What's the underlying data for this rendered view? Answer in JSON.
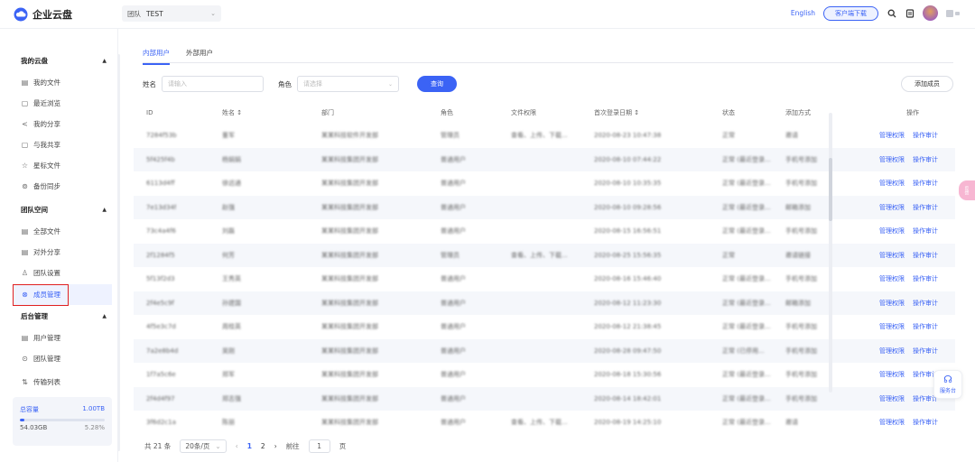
{
  "header": {
    "logo_text": "企业云盘",
    "team_label": "团队",
    "team_value": "TEST",
    "lang": "English",
    "download_label": "客户端下载",
    "brand_color": "#3b63f5"
  },
  "sidebar": {
    "my_group": "我的云盘",
    "my_items": [
      {
        "label": "我的文件",
        "icon": "file-icon"
      },
      {
        "label": "最近浏览",
        "icon": "recent-icon"
      },
      {
        "label": "我的分享",
        "icon": "share-icon"
      },
      {
        "label": "与我共享",
        "icon": "shared-with-me-icon"
      },
      {
        "label": "星标文件",
        "icon": "star-icon"
      },
      {
        "label": "备份同步",
        "icon": "sync-icon"
      }
    ],
    "team_group": "团队空间",
    "team_items": [
      {
        "label": "全部文件",
        "icon": "file-icon"
      },
      {
        "label": "对外分享",
        "icon": "external-share-icon"
      },
      {
        "label": "团队设置",
        "icon": "team-settings-icon"
      },
      {
        "label": "成员管理",
        "icon": "members-icon"
      }
    ],
    "admin_group": "后台管理",
    "admin_items": [
      {
        "label": "用户管理",
        "icon": "user-icon"
      },
      {
        "label": "团队管理",
        "icon": "team-icon"
      }
    ],
    "transfer_label": "传输列表",
    "storage": {
      "label": "总容量",
      "total": "1.00TB",
      "used": "54.03GB",
      "percent_text": "5.28%",
      "percent": 5.28
    }
  },
  "main": {
    "tabs": [
      "内部用户",
      "外部用户"
    ],
    "filters": {
      "name_label": "姓名",
      "name_placeholder": "请输入",
      "role_label": "角色",
      "role_placeholder": "请选择",
      "query_label": "查询",
      "add_label": "添加成员"
    },
    "columns": [
      "ID",
      "姓名 ↕",
      "部门",
      "角色",
      "文件权限",
      "首次登录日期 ↕",
      "状态",
      "添加方式",
      "操作"
    ],
    "ops": [
      "管理权限",
      "操作审计"
    ],
    "rows": [
      [
        "7284f53b",
        "董军",
        "某某科技软件开发部",
        "管理员",
        "查看、上传、下载...",
        "2020-08-23 10:47:38",
        "正常",
        "邀请"
      ],
      [
        "5f425f4b",
        "杨娟娟",
        "某某科技集团开发部",
        "普通用户",
        "",
        "2020-08-10 07:44:22",
        "正常 (最近登录...",
        "手机号添加"
      ],
      [
        "6113d4ff",
        "徐远通",
        "某某科技集团开发部",
        "普通用户",
        "",
        "2020-08-10 10:35:35",
        "正常 (最近登录...",
        "手机号添加"
      ],
      [
        "7e13d34f",
        "赵强",
        "某某科技集团开发部",
        "普通用户",
        "",
        "2020-08-10 09:28:56",
        "正常 (最近登录...",
        "邮箱添加"
      ],
      [
        "73c4a4f6",
        "刘磊",
        "某某科技集团开发部",
        "普通用户",
        "",
        "2020-08-15 16:56:51",
        "正常 (最近登录...",
        "手机号添加"
      ],
      [
        "2f1284f5",
        "何芳",
        "某某科技集团开发部",
        "管理员",
        "查看、上传、下载...",
        "2020-08-25 15:56:35",
        "正常",
        "邀请链接"
      ],
      [
        "5f13f2d3",
        "王秀英",
        "某某科技集团开发部",
        "普通用户",
        "",
        "2020-08-16 15:46:40",
        "正常 (最近登录...",
        "手机号添加"
      ],
      [
        "2f4e5c9f",
        "孙建国",
        "某某科技集团开发部",
        "普通用户",
        "",
        "2020-08-12 11:23:30",
        "正常 (最近登录...",
        "邮箱添加"
      ],
      [
        "4f5e3c7d",
        "周桂英",
        "某某科技集团开发部",
        "普通用户",
        "",
        "2020-08-12 21:38:45",
        "正常 (最近登录...",
        "手机号添加"
      ],
      [
        "7a2e8b4d",
        "吴刚",
        "某某科技集团开发部",
        "普通用户",
        "",
        "2020-08-28 09:47:50",
        "正常 (已停用...",
        "手机号添加"
      ],
      [
        "1f7a5c6e",
        "郑军",
        "某某科技集团开发部",
        "普通用户",
        "",
        "2020-08-18 15:30:56",
        "正常 (最近登录...",
        "手机号添加"
      ],
      [
        "2f4d4f97",
        "郑志强",
        "某某科技集团开发部",
        "普通用户",
        "",
        "2020-08-14 18:42:01",
        "正常 (最近登录...",
        "手机号添加"
      ],
      [
        "3f6d2c1a",
        "陈丽",
        "某某科技集团开发部",
        "普通用户",
        "查看、上传、下载...",
        "2020-08-19 14:25:10",
        "正常 (最近登录...",
        "邀请"
      ]
    ]
  },
  "pager": {
    "total_text": "共 21 条",
    "page_size": "20条/页",
    "pages": [
      "1",
      "2"
    ],
    "current": "1",
    "jump_prefix": "前往",
    "jump_value": "1",
    "jump_suffix": "页"
  },
  "floating": {
    "side_badge": "反馈",
    "service_label": "服务台"
  }
}
